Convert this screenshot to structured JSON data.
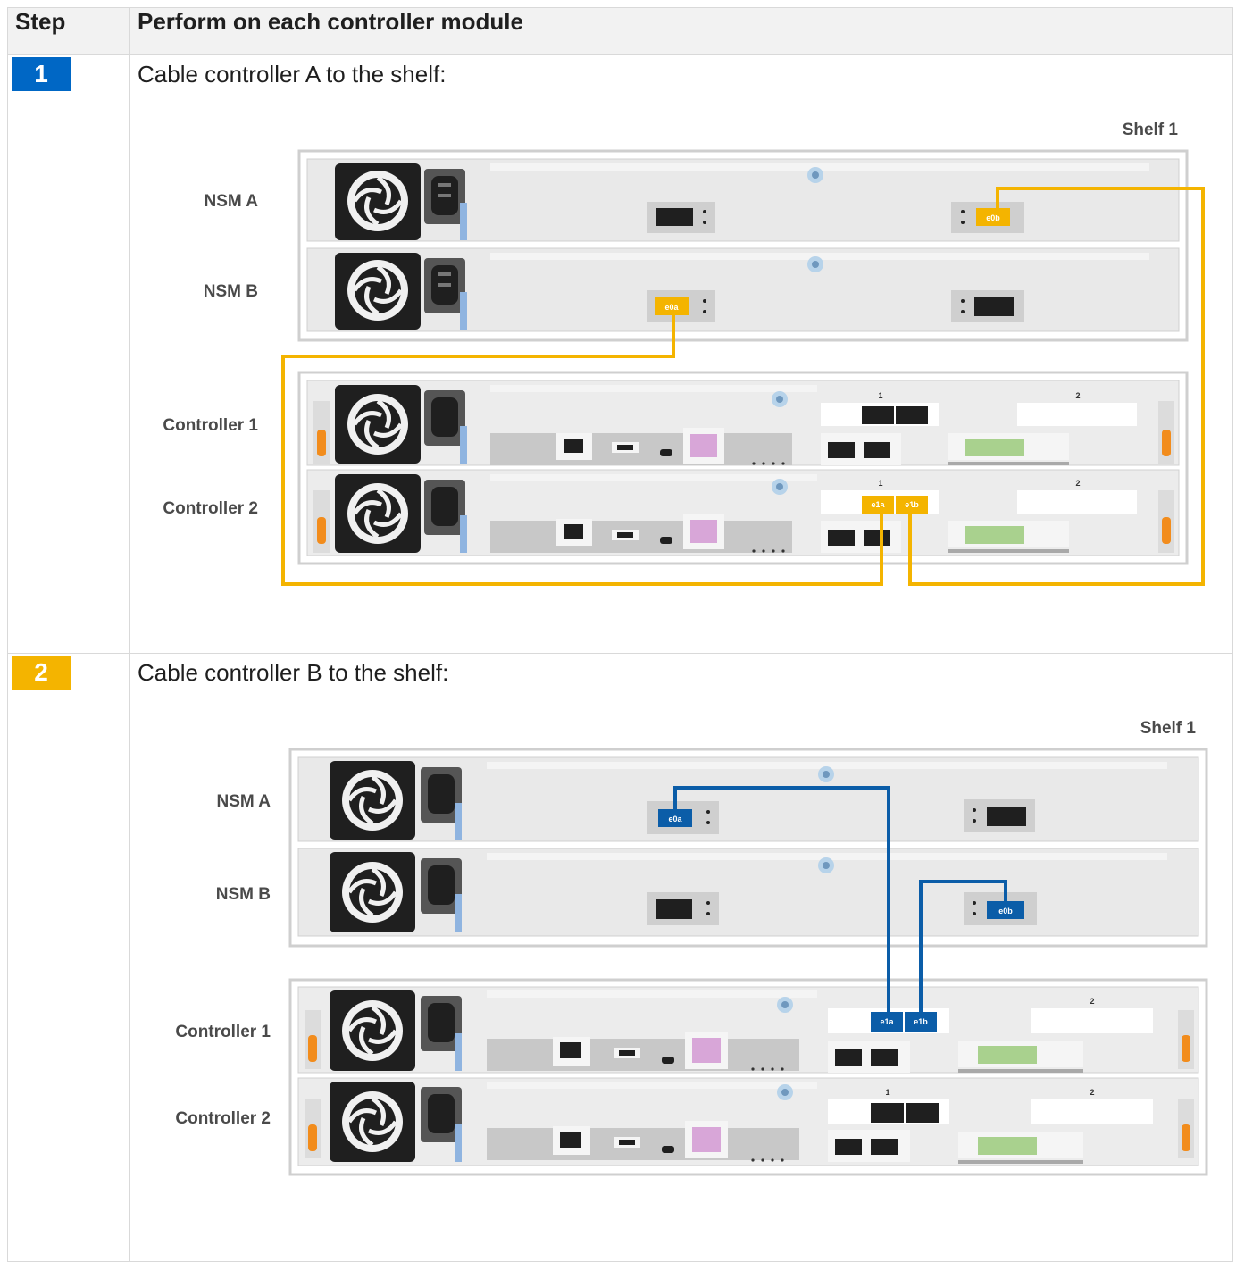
{
  "table": {
    "col_step": "Step",
    "col_action": "Perform on each controller module"
  },
  "steps": [
    {
      "number": "1",
      "badge_color": "#0067c5",
      "instruction": "Cable controller A to the shelf:",
      "cable_color": "#f4b400",
      "labels": {
        "shelf": "Shelf 1",
        "nsm_a": "NSM A",
        "nsm_b": "NSM B",
        "controller_1": "Controller 1",
        "controller_2": "Controller 2"
      },
      "ports": {
        "nsm_a_port": "e0b",
        "nsm_b_port": "e0a",
        "ctrl_port_a": "e1a",
        "ctrl_port_b": "e1b"
      },
      "slots": {
        "slot_1": "1",
        "slot_2": "2"
      }
    },
    {
      "number": "2",
      "badge_color": "#f4b400",
      "instruction": "Cable controller B to the shelf:",
      "cable_color": "#0b5da8",
      "labels": {
        "shelf": "Shelf 1",
        "nsm_a": "NSM A",
        "nsm_b": "NSM B",
        "controller_1": "Controller 1",
        "controller_2": "Controller 2"
      },
      "ports": {
        "nsm_a_port": "e0a",
        "nsm_b_port": "e0b",
        "ctrl_port_a": "e1a",
        "ctrl_port_b": "e1b"
      },
      "slots": {
        "slot_1": "1",
        "slot_2": "2"
      }
    }
  ]
}
